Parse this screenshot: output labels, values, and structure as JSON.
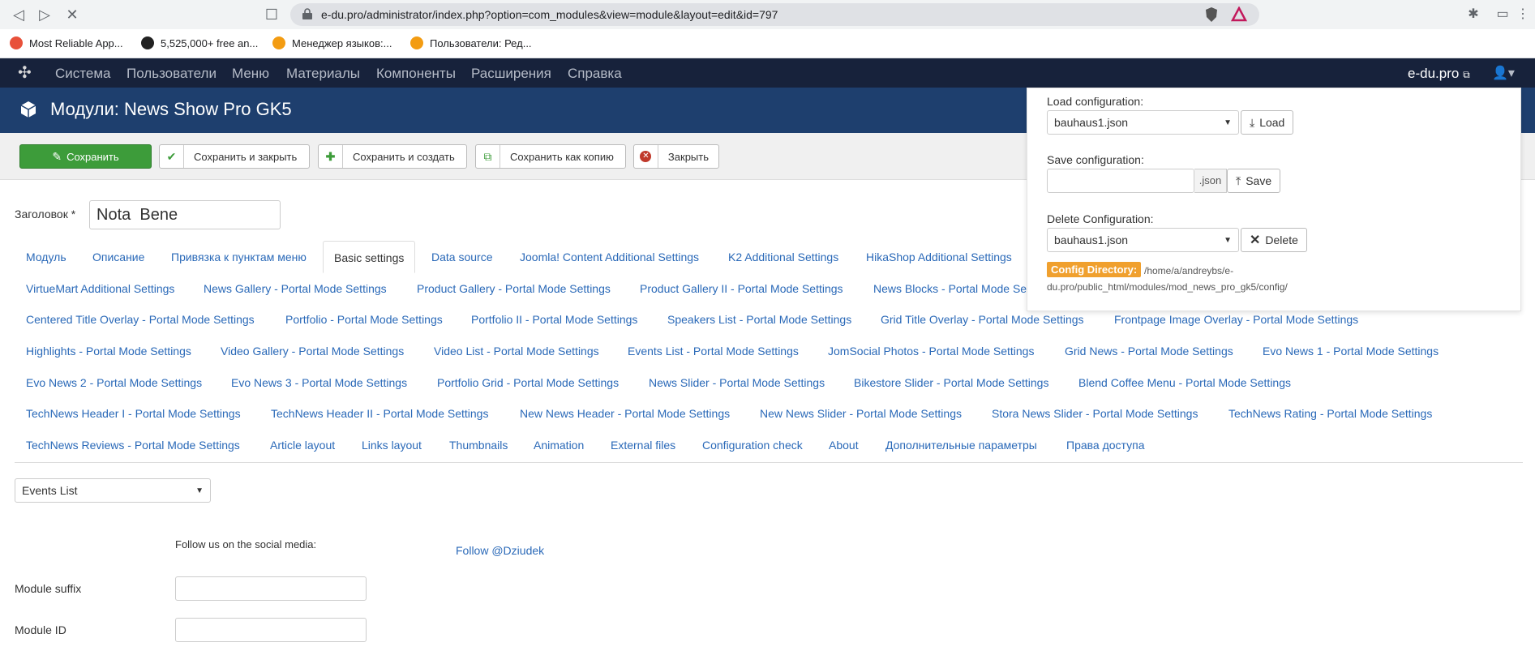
{
  "browser": {
    "url": "e-du.pro/administrator/index.php?option=com_modules&view=module&layout=edit&id=797",
    "bookmarks": [
      "Most Reliable App...",
      "5,525,000+ free an...",
      "Менеджер языков:...",
      "Пользователи: Ред..."
    ]
  },
  "navbar": {
    "menu": [
      "Система",
      "Пользователи",
      "Меню",
      "Материалы",
      "Компоненты",
      "Расширения",
      "Справка"
    ],
    "site": "e-du.pro"
  },
  "header": {
    "title": "Модули: News Show Pro GK5"
  },
  "toolbar": {
    "save": "Сохранить",
    "save_close": "Сохранить и закрыть",
    "save_new": "Сохранить и создать",
    "save_copy": "Сохранить как копию",
    "close": "Закрыть"
  },
  "form": {
    "title_label": "Заголовок *",
    "title_value": "Nota  Bene"
  },
  "tabs": [
    "Модуль",
    "Описание",
    "Привязка к пунктам меню",
    "Basic settings",
    "Data source",
    "Joomla! Content Additional Settings",
    "K2 Additional Settings",
    "HikaShop Additional Settings",
    "VirtueMart Additional Settings",
    "News Gallery - Portal Mode Settings",
    "Product Gallery - Portal Mode Settings",
    "Product Gallery II - Portal Mode Settings",
    "News Blocks - Portal Mode Se",
    "Centered Title Overlay - Portal Mode Settings",
    "Portfolio - Portal Mode Settings",
    "Portfolio II - Portal Mode Settings",
    "Speakers List - Portal Mode Settings",
    "Grid Title Overlay - Portal Mode Settings",
    "Frontpage Image Overlay - Portal Mode Settings",
    "Highlights - Portal Mode Settings",
    "Video Gallery - Portal Mode Settings",
    "Video List - Portal Mode Settings",
    "Events List - Portal Mode Settings",
    "JomSocial Photos - Portal Mode Settings",
    "Grid News - Portal Mode Settings",
    "Evo News 1 - Portal Mode Settings",
    "Evo News 2 - Portal Mode Settings",
    "Evo News 3 - Portal Mode Settings",
    "Portfolio Grid - Portal Mode Settings",
    "News Slider - Portal Mode Settings",
    "Bikestore Slider - Portal Mode Settings",
    "Blend Coffee Menu - Portal Mode Settings",
    "TechNews Header I - Portal Mode Settings",
    "TechNews Header II - Portal Mode Settings",
    "New News Header - Portal Mode Settings",
    "New News Slider - Portal Mode Settings",
    "Stora News Slider - Portal Mode Settings",
    "TechNews Rating - Portal Mode Settings",
    "TechNews Reviews - Portal Mode Settings",
    "Article layout",
    "Links layout",
    "Thumbnails",
    "Animation",
    "External files",
    "Configuration check",
    "About",
    "Дополнительные параметры",
    "Права доступа"
  ],
  "active_tab": "Basic settings",
  "basic": {
    "mode_select": "Events List",
    "social_label": "Follow us on the social media:",
    "follow_link": "Follow @Dziudek",
    "suffix_label": "Module suffix",
    "id_label": "Module ID"
  },
  "config": {
    "load_label": "Load configuration:",
    "load_value": "bauhaus1.json",
    "load_btn": "Load",
    "save_label": "Save configuration:",
    "json_suffix": ".json",
    "save_btn": "Save",
    "delete_label": "Delete Configuration:",
    "delete_value": "bauhaus1.json",
    "delete_btn": "Delete",
    "dir_label": "Config Directory:",
    "dir_path": "/home/a/andreybs/e-du.pro/public_html/modules/mod_news_pro_gk5/config/"
  }
}
